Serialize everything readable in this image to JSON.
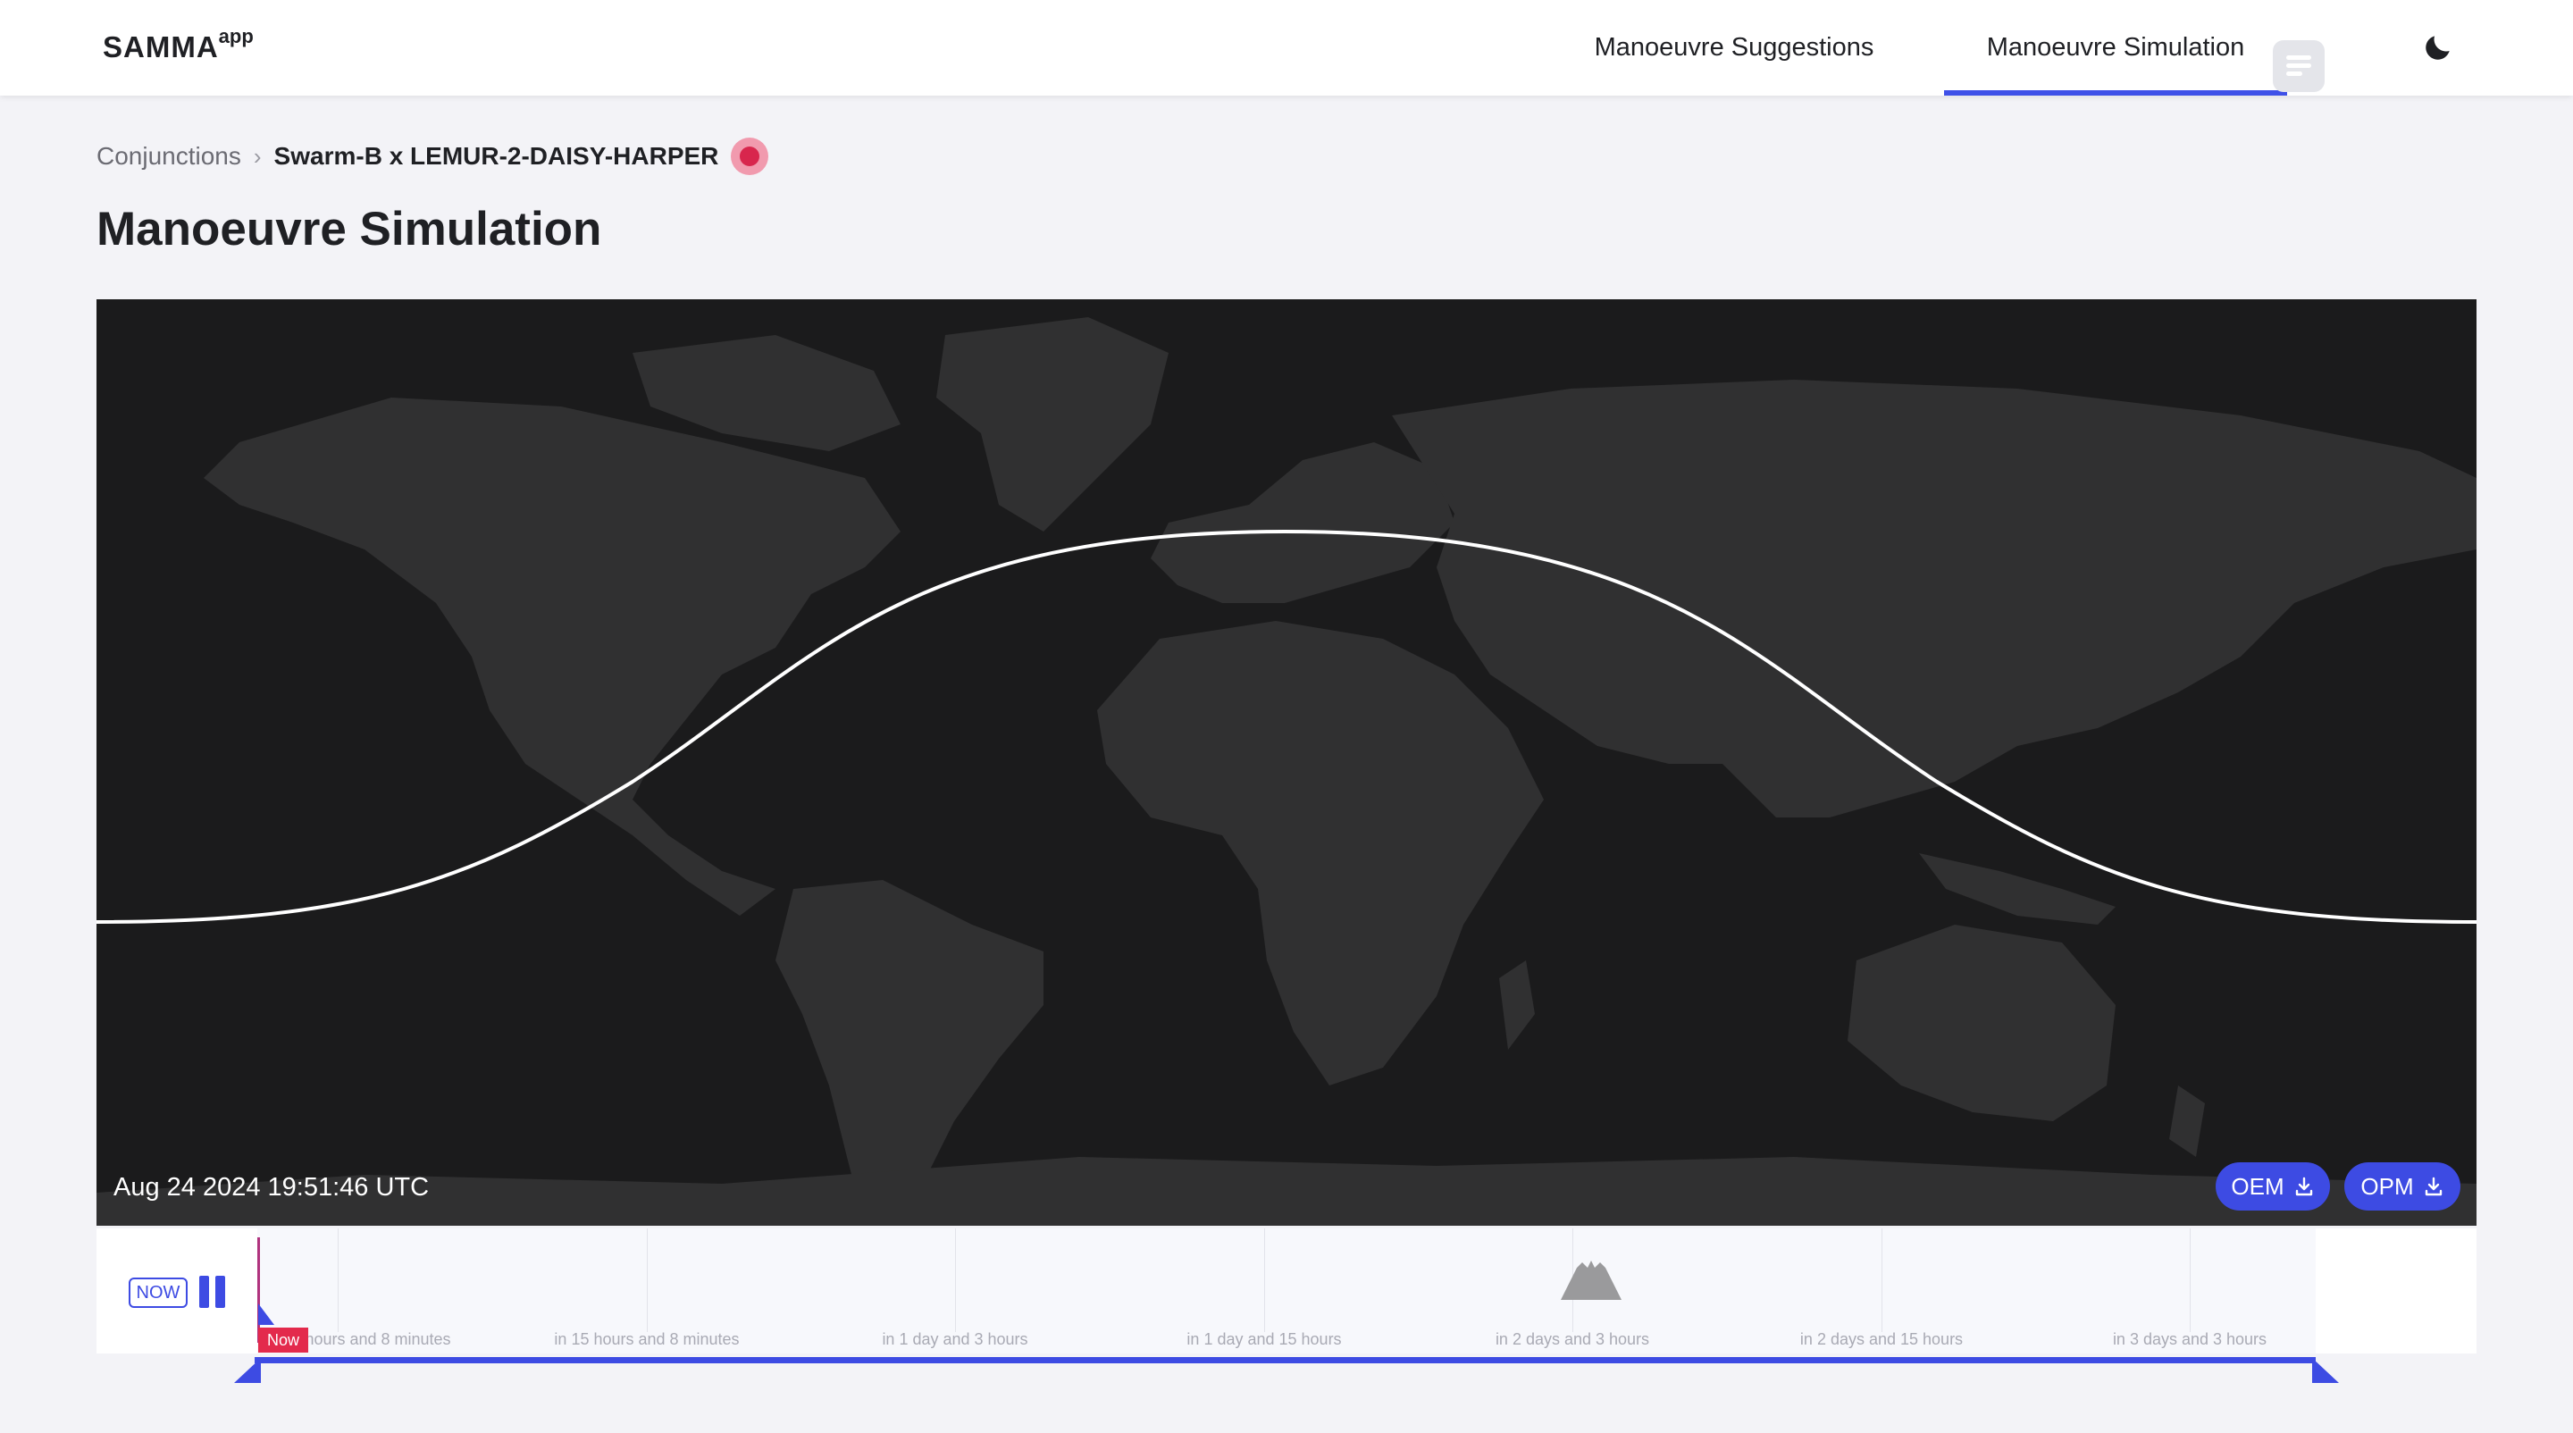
{
  "header": {
    "logo_main": "SAMMA",
    "logo_sup": "app",
    "tabs": [
      {
        "label": "Manoeuvre Suggestions",
        "active": false
      },
      {
        "label": "Manoeuvre Simulation",
        "active": true
      }
    ],
    "theme_icon": "moon-icon"
  },
  "breadcrumb": {
    "root": "Conjunctions",
    "separator_icon": "chevron-right-icon",
    "current": "Swarm-B x LEMUR-2-DAISY-HARPER",
    "risk_color": "#d8264d"
  },
  "page_title": "Manoeuvre Simulation",
  "map": {
    "timestamp": "Aug 24 2024 19:51:46 UTC",
    "ground_track_color": "#ffffff",
    "buttons": [
      {
        "label": "OEM",
        "icon": "download-icon"
      },
      {
        "label": "OPM",
        "icon": "download-icon"
      }
    ]
  },
  "timeline": {
    "now_button": "NOW",
    "pause_icon": "pause-icon",
    "now_tag": "Now",
    "labels": [
      "in 3 hours and 8 minutes",
      "in 15 hours and 8 minutes",
      "in 1 day and 3 hours",
      "in 1 day and 15 hours",
      "in 2 days and 3 hours",
      "in 2 days and 15 hours",
      "in 3 days and 3 hours"
    ],
    "event_icon": "conjunction-event-icon",
    "menu_icon": "list-icon",
    "accent": "#3d4be3"
  }
}
